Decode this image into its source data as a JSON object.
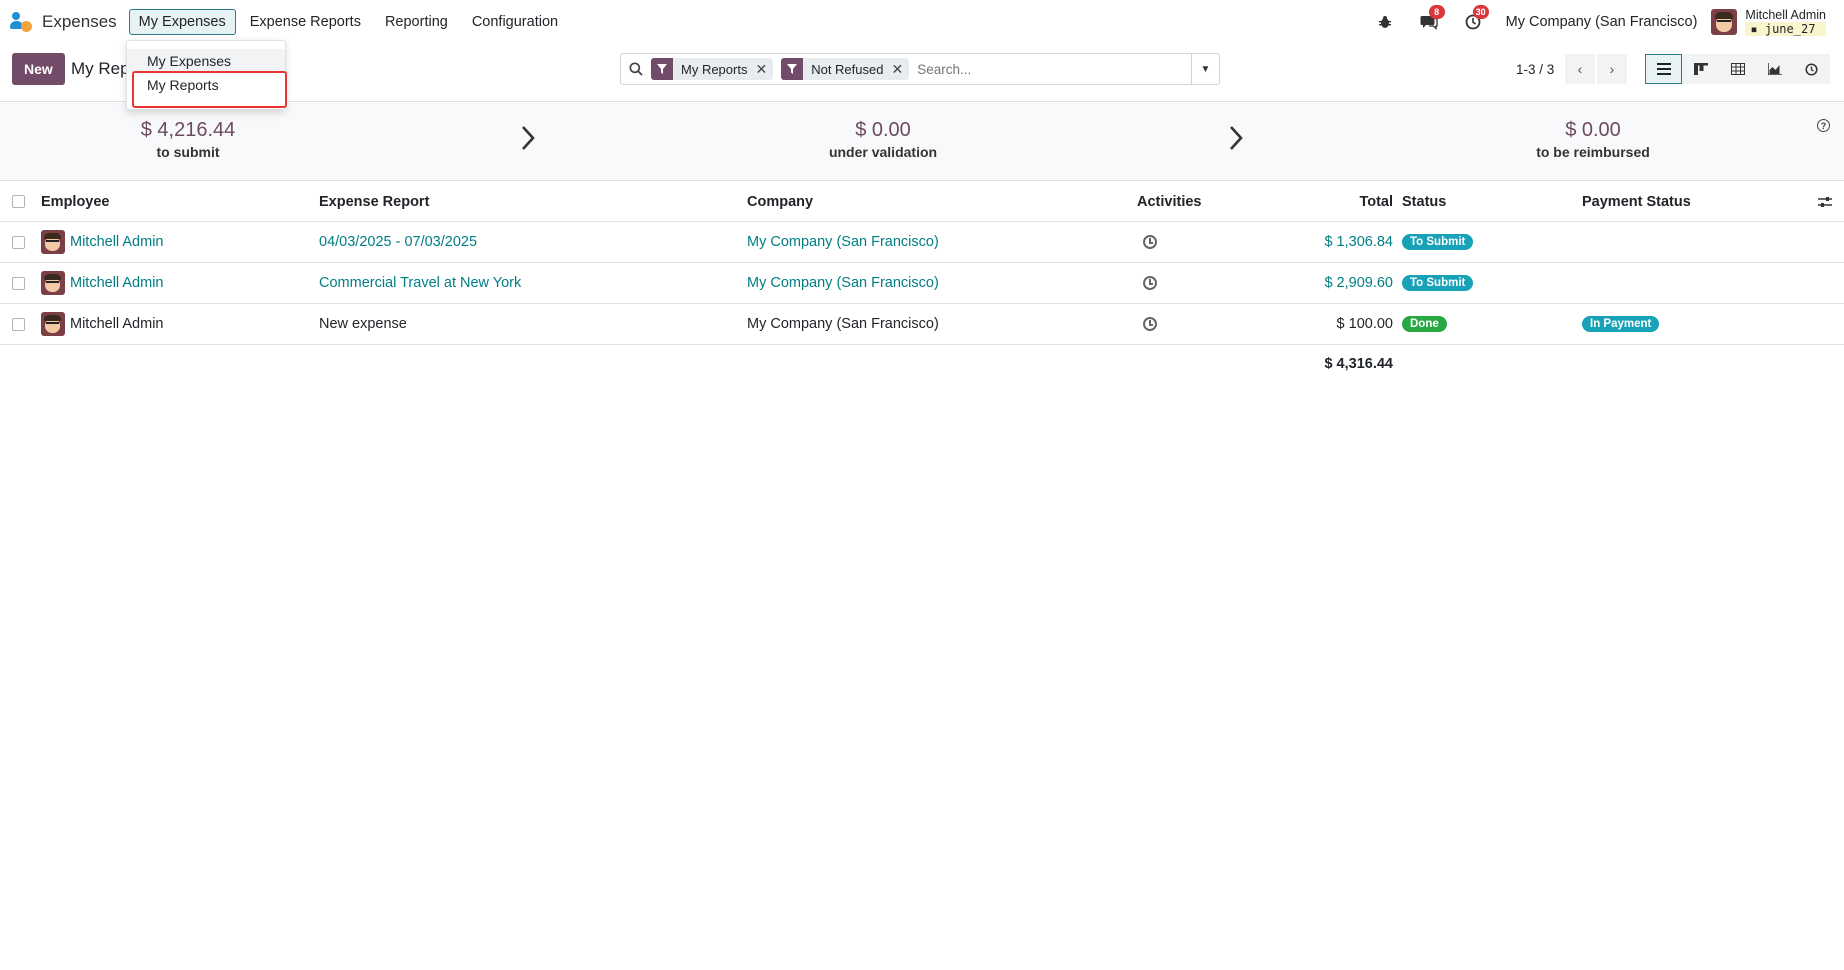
{
  "app": {
    "name": "Expenses"
  },
  "menu": {
    "items": [
      {
        "label": "My Expenses",
        "active": true
      },
      {
        "label": "Expense Reports"
      },
      {
        "label": "Reporting"
      },
      {
        "label": "Configuration"
      }
    ]
  },
  "dropdown": {
    "items": [
      "My Expenses",
      "My Reports"
    ]
  },
  "systray": {
    "messages_count": "8",
    "activities_count": "30",
    "company": "My Company (San Francisco)",
    "user_name": "Mitchell Admin",
    "db_name": "june_27"
  },
  "control": {
    "new_label": "New",
    "breadcrumb": "My Rep",
    "facets": [
      "My Reports",
      "Not Refused"
    ],
    "search_placeholder": "Search...",
    "pager": "1-3 / 3"
  },
  "stats": [
    {
      "amount": "$ 4,216.44",
      "label": "to submit"
    },
    {
      "amount": "$ 0.00",
      "label": "under validation"
    },
    {
      "amount": "$ 0.00",
      "label": "to be reimbursed"
    }
  ],
  "table": {
    "headers": {
      "employee": "Employee",
      "report": "Expense Report",
      "company": "Company",
      "activities": "Activities",
      "total": "Total",
      "status": "Status",
      "payment": "Payment Status"
    },
    "rows": [
      {
        "employee": "Mitchell Admin",
        "report": "04/03/2025 - 07/03/2025",
        "company": "My Company (San Francisco)",
        "total": "$ 1,306.84",
        "status": "To Submit",
        "payment": ""
      },
      {
        "employee": "Mitchell Admin",
        "report": "Commercial Travel at New York",
        "company": "My Company (San Francisco)",
        "total": "$ 2,909.60",
        "status": "To Submit",
        "payment": ""
      },
      {
        "employee": "Mitchell Admin",
        "report": "New expense",
        "company": "My Company (San Francisco)",
        "total": "$ 100.00",
        "status": "Done",
        "payment": "In Payment"
      }
    ],
    "grand_total": "$ 4,316.44"
  },
  "colors": {
    "brand": "#714b67",
    "link": "#017e84",
    "status_to_submit": "#17a2b8",
    "status_done": "#28a745",
    "payment_in_payment": "#17a2b8"
  }
}
